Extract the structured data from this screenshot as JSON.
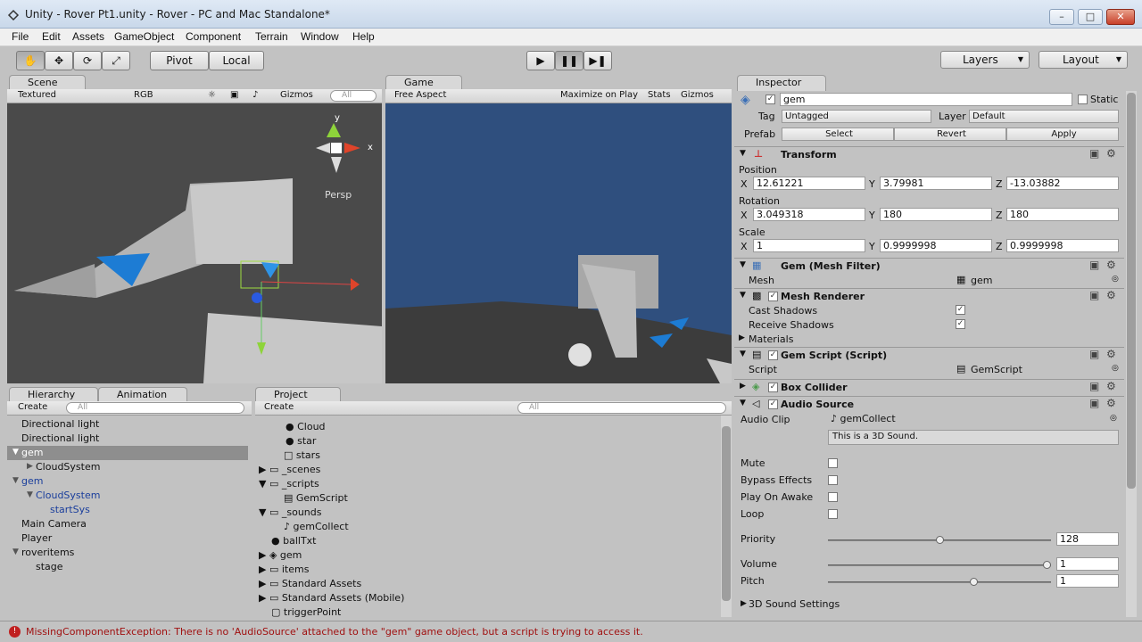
{
  "window": {
    "title": "Unity - Rover Pt1.unity - Rover - PC and Mac Standalone*"
  },
  "menu": [
    "File",
    "Edit",
    "Assets",
    "GameObject",
    "Component",
    "Terrain",
    "Window",
    "Help"
  ],
  "toolbar": {
    "pivot": "Pivot",
    "local": "Local",
    "layers": "Layers",
    "layout": "Layout"
  },
  "scene": {
    "tab": "Scene",
    "render_mode": "Textured",
    "color": "RGB",
    "gizmos": "Gizmos",
    "search": "All",
    "persp": "Persp",
    "axis_y": "y",
    "axis_x": "x"
  },
  "game": {
    "tab": "Game",
    "aspect": "Free Aspect",
    "maximize": "Maximize on Play",
    "stats": "Stats",
    "gizmos": "Gizmos"
  },
  "hierarchy": {
    "tab": "Hierarchy",
    "tab2": "Animation",
    "create": "Create",
    "search": "All",
    "items": [
      "Directional light",
      "Directional light",
      "gem",
      "CloudSystem",
      "gem",
      "CloudSystem",
      "startSys",
      "Main Camera",
      "Player",
      "roveritems",
      "stage"
    ]
  },
  "project": {
    "tab": "Project",
    "create": "Create",
    "search": "All",
    "items": [
      "Cloud",
      "star",
      "stars",
      "_scenes",
      "_scripts",
      "GemScript",
      "_sounds",
      "gemCollect",
      "ballTxt",
      "gem",
      "items",
      "Standard Assets",
      "Standard Assets (Mobile)",
      "triggerPoint"
    ]
  },
  "inspector": {
    "tab": "Inspector",
    "name": "gem",
    "static": "Static",
    "tag_label": "Tag",
    "tag": "Untagged",
    "layer_label": "Layer",
    "layer": "Default",
    "prefab_label": "Prefab",
    "select": "Select",
    "revert": "Revert",
    "apply": "Apply",
    "transform": {
      "title": "Transform",
      "position": "Position",
      "rotation": "Rotation",
      "scale": "Scale",
      "pos": [
        "12.61221",
        "3.79981",
        "-13.03882"
      ],
      "rot": [
        "3.049318",
        "180",
        "180"
      ],
      "scl": [
        "1",
        "0.9999998",
        "0.9999998"
      ],
      "axis_labels": [
        "X",
        "Y",
        "Z"
      ]
    },
    "mesh_filter": {
      "title": "Gem (Mesh Filter)",
      "mesh_label": "Mesh",
      "mesh": "gem"
    },
    "mesh_renderer": {
      "title": "Mesh Renderer",
      "cast": "Cast Shadows",
      "receive": "Receive Shadows",
      "materials": "Materials"
    },
    "gem_script": {
      "title": "Gem Script (Script)",
      "label": "Script",
      "value": "GemScript"
    },
    "box_collider": {
      "title": "Box Collider"
    },
    "audio_source": {
      "title": "Audio Source",
      "clip_label": "Audio Clip",
      "clip": "gemCollect",
      "info": "This is a 3D Sound.",
      "mute": "Mute",
      "bypass": "Bypass Effects",
      "play_on_awake": "Play On Awake",
      "loop": "Loop",
      "priority_label": "Priority",
      "priority": "128",
      "volume_label": "Volume",
      "volume": "1",
      "pitch_label": "Pitch",
      "pitch": "1",
      "settings": "3D Sound Settings",
      "priority_level": 0.5,
      "volume_level": 1.0,
      "pitch_level": 0.66
    }
  },
  "status": {
    "error": "MissingComponentException: There is no 'AudioSource' attached to the \"gem\" game object, but a script is trying to access it."
  },
  "colors": {
    "sky": "#2f4f7e",
    "selection": "#8e8e8e",
    "error": "#c02020",
    "blue_text": "#1a3e9c"
  }
}
